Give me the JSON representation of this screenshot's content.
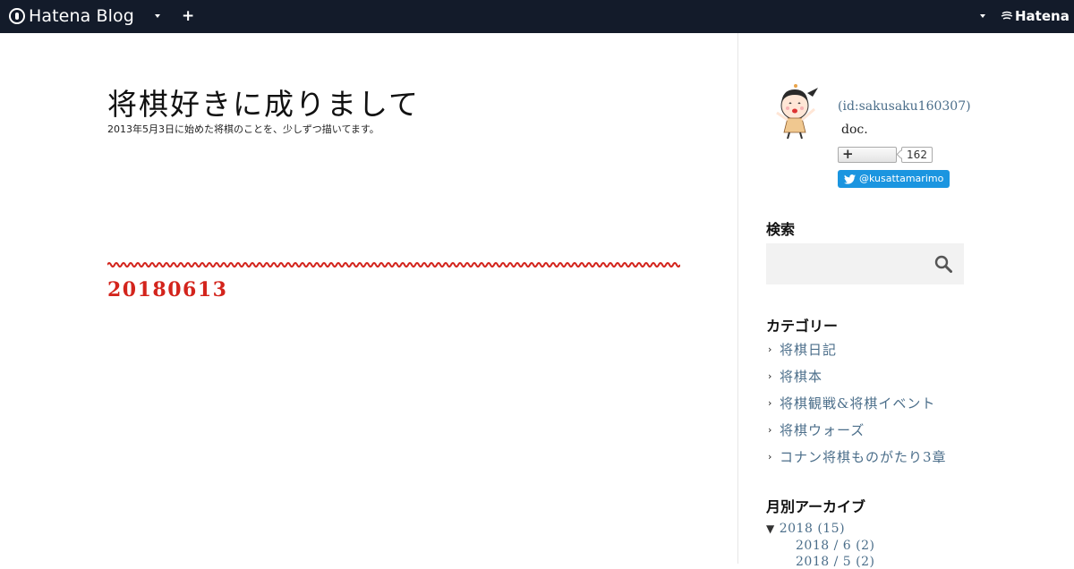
{
  "topbar": {
    "logo_text": "Hatena Blog",
    "logo_icon": "hatena-blog-logo-icon",
    "menu_caret_icon": "chevron-down-icon",
    "add_icon": "plus-icon",
    "add_symbol": "+",
    "hatena_text": "Hatena",
    "hatena_icon": "hatena-mark-icon",
    "background_color": "#131b2a"
  },
  "blog": {
    "title": "将棋好きに成りまして",
    "description": "2013年5月3日に始めた将棋のことを、少しずつ描いてます。"
  },
  "entry": {
    "title": "20180613",
    "title_color": "#d3241c",
    "divider_color": "#d3241c"
  },
  "profile": {
    "avatar_icon": "character-avatar-icon",
    "id_text": "(id:sakusaku160307)",
    "description": "doc.",
    "subscribe_symbol": "+",
    "subscriber_count": "162",
    "twitter_label": "@kusattamarimo",
    "twitter_color": "#1b95e0"
  },
  "sidebar": {
    "search_heading": "検索",
    "search_placeholder": "",
    "search_icon": "search-icon",
    "categories_heading": "カテゴリー",
    "categories": [
      {
        "label": "将棋日記"
      },
      {
        "label": "将棋本"
      },
      {
        "label": "将棋観戦&将棋イベント"
      },
      {
        "label": "将棋ウォーズ"
      },
      {
        "label": "コナン将棋ものがたり3章"
      }
    ],
    "archive_heading": "月別アーカイブ",
    "archive": {
      "toggle_symbol": "▼",
      "year_label": "2018 (15)",
      "months": [
        {
          "label": "2018 / 6 (2)"
        },
        {
          "label": "2018 / 5 (2)"
        }
      ]
    },
    "link_color": "#4b6e8a"
  }
}
